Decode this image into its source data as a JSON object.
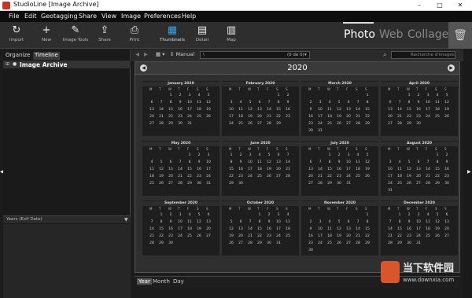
{
  "window": {
    "title": "StudioLine [Image Archive]",
    "minimize": "–",
    "maximize": "□",
    "close": "✕"
  },
  "menu": [
    "File",
    "Edit",
    "Geotagging",
    "Share",
    "View",
    "Image",
    "Preferences",
    "Help"
  ],
  "toolbar": [
    {
      "icon": "import-icon",
      "glyph": "↻",
      "label": "Import"
    },
    {
      "icon": "new-icon",
      "glyph": "+",
      "label": "New"
    },
    {
      "icon": "image-tools-icon",
      "glyph": "✎",
      "label": "Image Tools"
    },
    {
      "icon": "share-icon",
      "glyph": "⇪",
      "label": "Share"
    },
    {
      "icon": "print-icon",
      "glyph": "⎙",
      "label": "Print"
    },
    {
      "icon": "thumbnails-icon",
      "glyph": "▦",
      "label": "Thumbnails",
      "active": true
    },
    {
      "icon": "detail-icon",
      "glyph": "▤",
      "label": "Detail"
    },
    {
      "icon": "map-icon",
      "glyph": "▥",
      "label": "Map"
    }
  ],
  "modes": [
    {
      "label": "Photo",
      "active": true
    },
    {
      "label": "Web",
      "active": false
    },
    {
      "label": "Collage",
      "active": false
    }
  ],
  "trash_glyph": "🗑",
  "left_panel": {
    "tabs": [
      {
        "label": "Organize",
        "selected": false
      },
      {
        "label": "Timeline",
        "selected": true
      }
    ],
    "tree_expand": "⊞",
    "tree_dot": "●",
    "tree_item": "Image Archive",
    "years_dropdown": "Years (Exif Date)",
    "years_arrow": "▼"
  },
  "navbar": {
    "back": "◀",
    "forward": "▶",
    "view_menu": "▦ ▾",
    "sort": "↕ Manual",
    "path": "\\",
    "count": "(0 de 0)",
    "count_arrow": "▾",
    "search_icon_glyph": "⌕",
    "search_placeholder": "Recherche d'images"
  },
  "calendar": {
    "year": "2020",
    "prev": "◀",
    "next": "▶",
    "weekdays": [
      "M",
      "T",
      "W",
      "T",
      "F",
      "S",
      "S"
    ],
    "months": [
      {
        "name": "January 2020",
        "offset": 2,
        "days": 31
      },
      {
        "name": "February 2020",
        "offset": 5,
        "days": 29
      },
      {
        "name": "March 2020",
        "offset": 6,
        "days": 31
      },
      {
        "name": "April 2020",
        "offset": 2,
        "days": 30
      },
      {
        "name": "May 2020",
        "offset": 4,
        "days": 31
      },
      {
        "name": "June 2020",
        "offset": 0,
        "days": 30
      },
      {
        "name": "July 2020",
        "offset": 2,
        "days": 31
      },
      {
        "name": "August 2020",
        "offset": 5,
        "days": 31
      },
      {
        "name": "September 2020",
        "offset": 1,
        "days": 30
      },
      {
        "name": "October 2020",
        "offset": 3,
        "days": 31
      },
      {
        "name": "November 2020",
        "offset": 6,
        "days": 30
      },
      {
        "name": "December 2020",
        "offset": 1,
        "days": 31
      }
    ]
  },
  "bottom_tabs": [
    {
      "label": "Year",
      "selected": true
    },
    {
      "label": "Month",
      "selected": false
    },
    {
      "label": "Day",
      "selected": false
    }
  ],
  "watermark": {
    "title": "当下软件园",
    "url": "www.downxia.com"
  }
}
